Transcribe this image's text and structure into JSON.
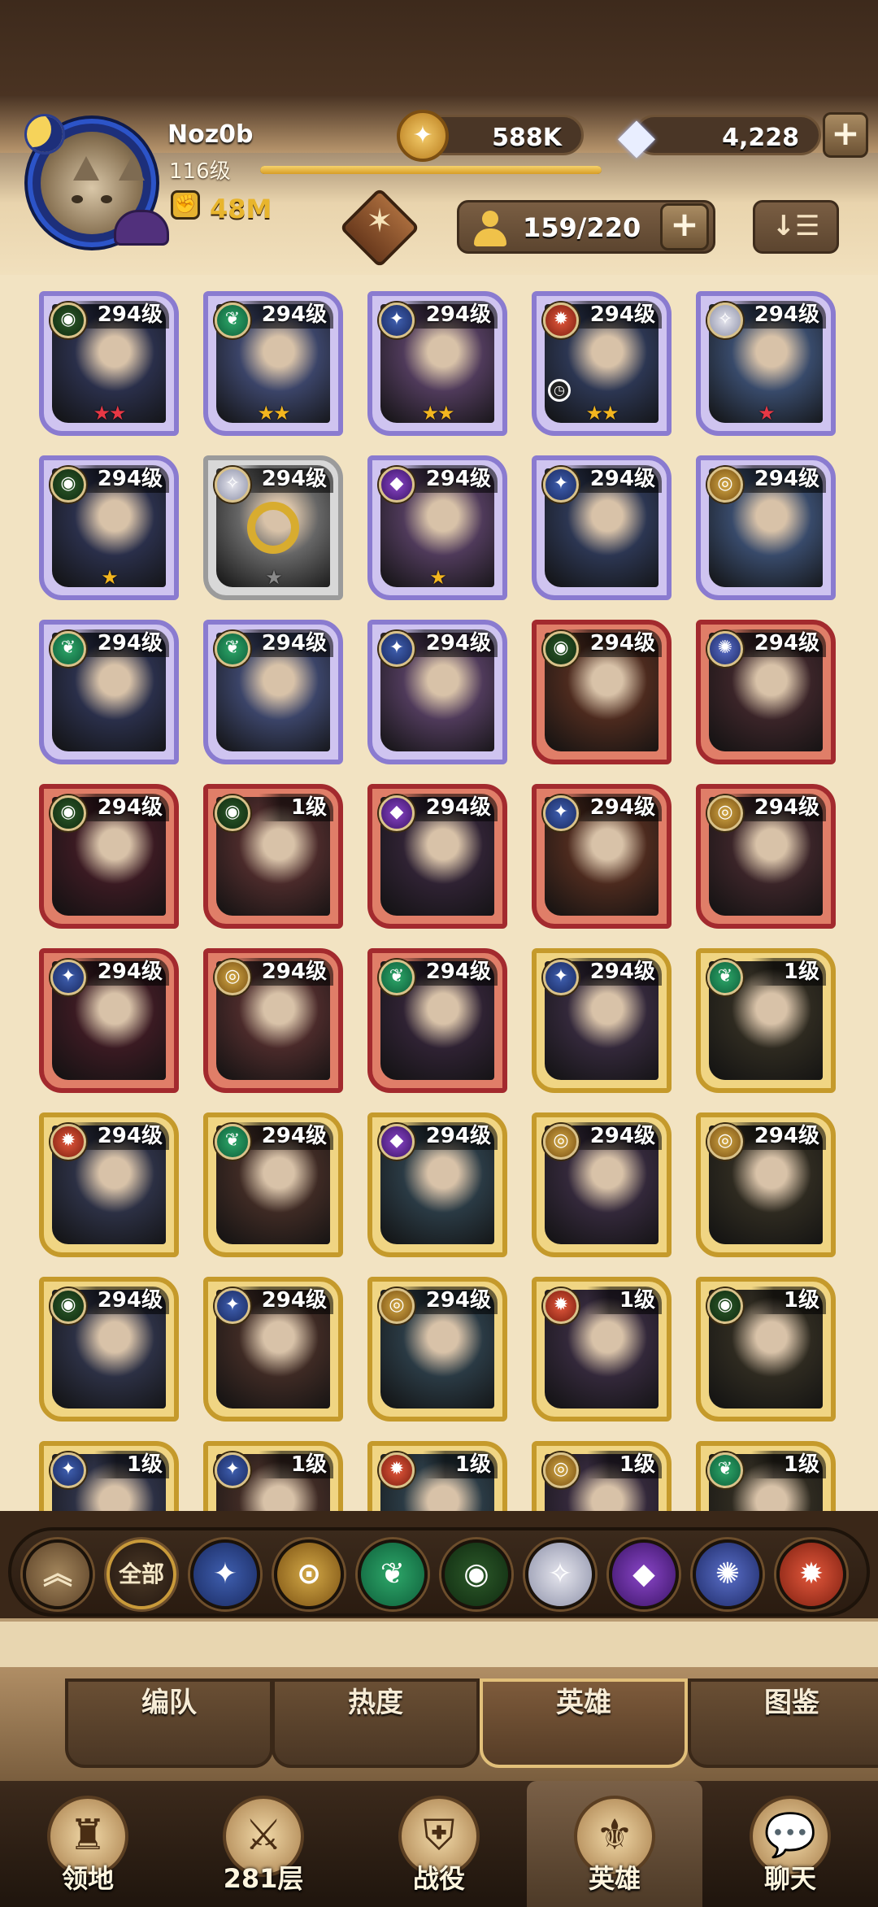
{
  "player": {
    "name": "Noz0b",
    "level": "116级",
    "power": "48M"
  },
  "resources": {
    "gold": "588K",
    "gems": "4,228"
  },
  "roster": {
    "capacity": "159/220"
  },
  "heroes": [
    {
      "level": "294级",
      "frame": "purple",
      "faction": "gb",
      "stars": "★★",
      "star_color": "red"
    },
    {
      "level": "294级",
      "frame": "purple",
      "faction": "lb",
      "stars": "★★",
      "star_color": "gold"
    },
    {
      "level": "294级",
      "frame": "purple",
      "faction": "ll",
      "stars": "★★",
      "star_color": "gold"
    },
    {
      "level": "294级",
      "frame": "purple",
      "faction": "wd",
      "stars": "★★",
      "star_color": "gold",
      "clock": true
    },
    {
      "level": "294级",
      "frame": "purple",
      "faction": "cl",
      "stars": "★",
      "star_color": "red"
    },
    {
      "level": "294级",
      "frame": "purple",
      "faction": "gb",
      "stars": "★",
      "star_color": "gold"
    },
    {
      "level": "294级",
      "frame": "gray",
      "faction": "cl",
      "stars": "★",
      "star_color": "gray",
      "chain": true
    },
    {
      "level": "294级",
      "frame": "purple",
      "faction": "hy",
      "stars": "★",
      "star_color": "gold"
    },
    {
      "level": "294级",
      "frame": "purple",
      "faction": "ll",
      "stars": "",
      "star_color": "gold"
    },
    {
      "level": "294级",
      "frame": "purple",
      "faction": "ma",
      "stars": "",
      "star_color": "gold"
    },
    {
      "level": "294级",
      "frame": "purple",
      "faction": "lb",
      "stars": "",
      "star_color": "gold"
    },
    {
      "level": "294级",
      "frame": "purple",
      "faction": "lb",
      "stars": "",
      "star_color": "gold"
    },
    {
      "level": "294级",
      "frame": "purple",
      "faction": "ll",
      "stars": "",
      "star_color": "gold"
    },
    {
      "level": "294级",
      "frame": "red",
      "faction": "gb",
      "stars": "",
      "star_color": "gold"
    },
    {
      "level": "294级",
      "frame": "red",
      "faction": "dm",
      "stars": "",
      "star_color": "gold"
    },
    {
      "level": "294级",
      "frame": "red",
      "faction": "gb",
      "stars": "",
      "star_color": "gold"
    },
    {
      "level": "1级",
      "frame": "red",
      "faction": "gb",
      "stars": "",
      "star_color": "gold"
    },
    {
      "level": "294级",
      "frame": "red",
      "faction": "hy",
      "stars": "",
      "star_color": "gold"
    },
    {
      "level": "294级",
      "frame": "red",
      "faction": "ll",
      "stars": "",
      "star_color": "gold"
    },
    {
      "level": "294级",
      "frame": "red",
      "faction": "ma",
      "stars": "",
      "star_color": "gold"
    },
    {
      "level": "294级",
      "frame": "red",
      "faction": "ll",
      "stars": "",
      "star_color": "gold"
    },
    {
      "level": "294级",
      "frame": "red",
      "faction": "ma",
      "stars": "",
      "star_color": "gold"
    },
    {
      "level": "294级",
      "frame": "red",
      "faction": "lb",
      "stars": "",
      "star_color": "gold"
    },
    {
      "level": "294级",
      "frame": "gold",
      "faction": "ll",
      "stars": "",
      "star_color": "gold"
    },
    {
      "level": "1级",
      "frame": "gold",
      "faction": "lb",
      "stars": "",
      "star_color": "gold"
    },
    {
      "level": "294级",
      "frame": "gold",
      "faction": "wd",
      "stars": "",
      "star_color": "gold"
    },
    {
      "level": "294级",
      "frame": "gold",
      "faction": "lb",
      "stars": "",
      "star_color": "gold"
    },
    {
      "level": "294级",
      "frame": "gold",
      "faction": "hy",
      "stars": "",
      "star_color": "gold"
    },
    {
      "level": "294级",
      "frame": "gold",
      "faction": "ma",
      "stars": "",
      "star_color": "gold"
    },
    {
      "level": "294级",
      "frame": "gold",
      "faction": "ma",
      "stars": "",
      "star_color": "gold"
    },
    {
      "level": "294级",
      "frame": "gold",
      "faction": "gb",
      "stars": "",
      "star_color": "gold"
    },
    {
      "level": "294级",
      "frame": "gold",
      "faction": "ll",
      "stars": "",
      "star_color": "gold"
    },
    {
      "level": "294级",
      "frame": "gold",
      "faction": "ma",
      "stars": "",
      "star_color": "gold"
    },
    {
      "level": "1级",
      "frame": "gold",
      "faction": "wd",
      "stars": "",
      "star_color": "gold"
    },
    {
      "level": "1级",
      "frame": "gold",
      "faction": "gb",
      "stars": "",
      "star_color": "gold"
    },
    {
      "level": "1级",
      "frame": "gold",
      "faction": "ll",
      "stars": "",
      "star_color": "gold"
    },
    {
      "level": "1级",
      "frame": "gold",
      "faction": "ll",
      "stars": "",
      "star_color": "gold"
    },
    {
      "level": "1级",
      "frame": "gold",
      "faction": "wd",
      "stars": "",
      "star_color": "gold"
    },
    {
      "level": "1级",
      "frame": "gold",
      "faction": "ma",
      "stars": "",
      "star_color": "gold"
    },
    {
      "level": "1级",
      "frame": "gold",
      "faction": "lb",
      "stars": "",
      "star_color": "gold"
    }
  ],
  "filters": {
    "all_label": "全部",
    "items": [
      {
        "name": "scroll-up",
        "icon": "chevron-up-icon"
      },
      {
        "name": "all",
        "icon": "all-label"
      },
      {
        "name": "lightbearer",
        "icon": "star-compass-icon"
      },
      {
        "name": "mauler",
        "icon": "ring-icon"
      },
      {
        "name": "wilder",
        "icon": "leaf-icon"
      },
      {
        "name": "graveborn",
        "icon": "eye-icon"
      },
      {
        "name": "celestial",
        "icon": "sunburst-icon"
      },
      {
        "name": "hypogean",
        "icon": "void-crystal-icon"
      },
      {
        "name": "dimensional",
        "icon": "portal-icon"
      },
      {
        "name": "flame",
        "icon": "flame-icon"
      }
    ]
  },
  "tabs": [
    {
      "label": "编队"
    },
    {
      "label": "热度"
    },
    {
      "label": "英雄"
    },
    {
      "label": "图鉴"
    }
  ],
  "nav": [
    {
      "label": "领地"
    },
    {
      "label": "281层"
    },
    {
      "label": "战役"
    },
    {
      "label": "英雄"
    },
    {
      "label": "聊天"
    }
  ]
}
